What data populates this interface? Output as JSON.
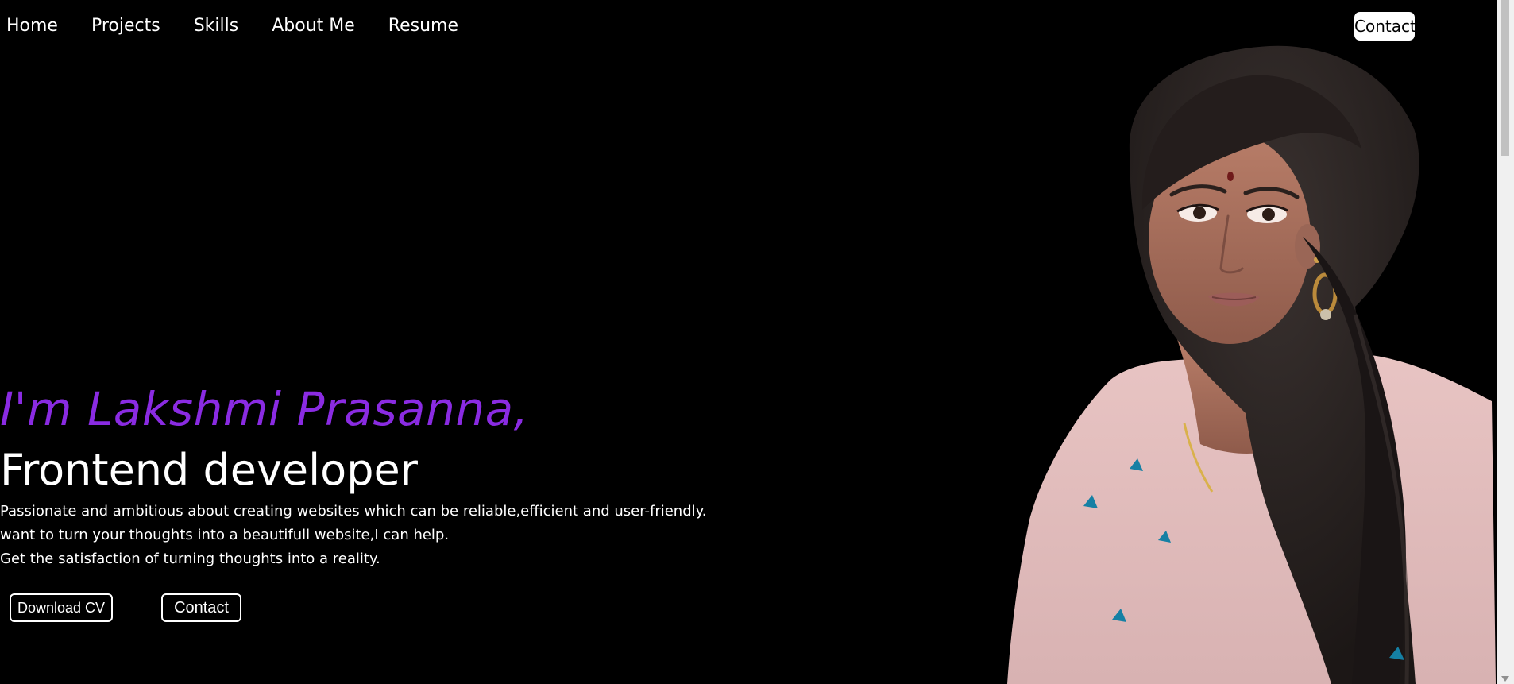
{
  "nav": {
    "items": [
      "Home",
      "Projects",
      "Skills",
      "About Me",
      "Resume"
    ],
    "contact_label": "Contact"
  },
  "hero": {
    "title": "I'm Lakshmi Prasanna,",
    "subtitle": "Frontend developer",
    "lines": [
      "Passionate and ambitious about creating websites which can be reliable,efficient and user-friendly.",
      "want to turn your thoughts into a beautifull website,I can help.",
      "Get the satisfaction of turning thoughts into a reality."
    ],
    "download_label": "Download CV",
    "contact_label": "Contact"
  },
  "colors": {
    "background": "#000000",
    "accent": "#8a2be2",
    "text": "#ffffff"
  },
  "icons": {
    "portrait": "profile-portrait"
  }
}
